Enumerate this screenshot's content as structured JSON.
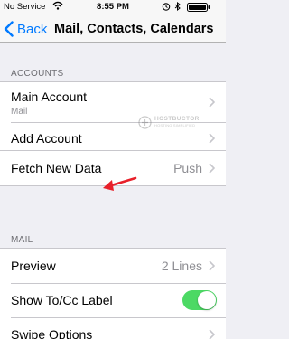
{
  "status_bar": {
    "carrier": "No Service",
    "time": "8:55 PM"
  },
  "nav": {
    "back_label": "Back",
    "title": "Mail, Contacts, Calendars"
  },
  "sections": {
    "accounts_header": "ACCOUNTS",
    "mail_header": "MAIL"
  },
  "accounts": [
    {
      "label": "Main Account",
      "subtitle": "Mail"
    },
    {
      "label": "Add Account"
    }
  ],
  "fetch": {
    "label": "Fetch New Data",
    "value": "Push"
  },
  "mail_settings": {
    "preview": {
      "label": "Preview",
      "value": "2 Lines"
    },
    "show_tocc": {
      "label": "Show To/Cc Label",
      "enabled": true
    },
    "swipe": {
      "label": "Swipe Options"
    }
  },
  "watermark": {
    "title": "HOSTBUCTOR",
    "subtitle": "HOSTING SIMPLIFIED"
  },
  "colors": {
    "accent": "#007aff",
    "toggle_on": "#4cd964",
    "annotation_arrow": "#e8202a",
    "background": "#efeff4"
  }
}
